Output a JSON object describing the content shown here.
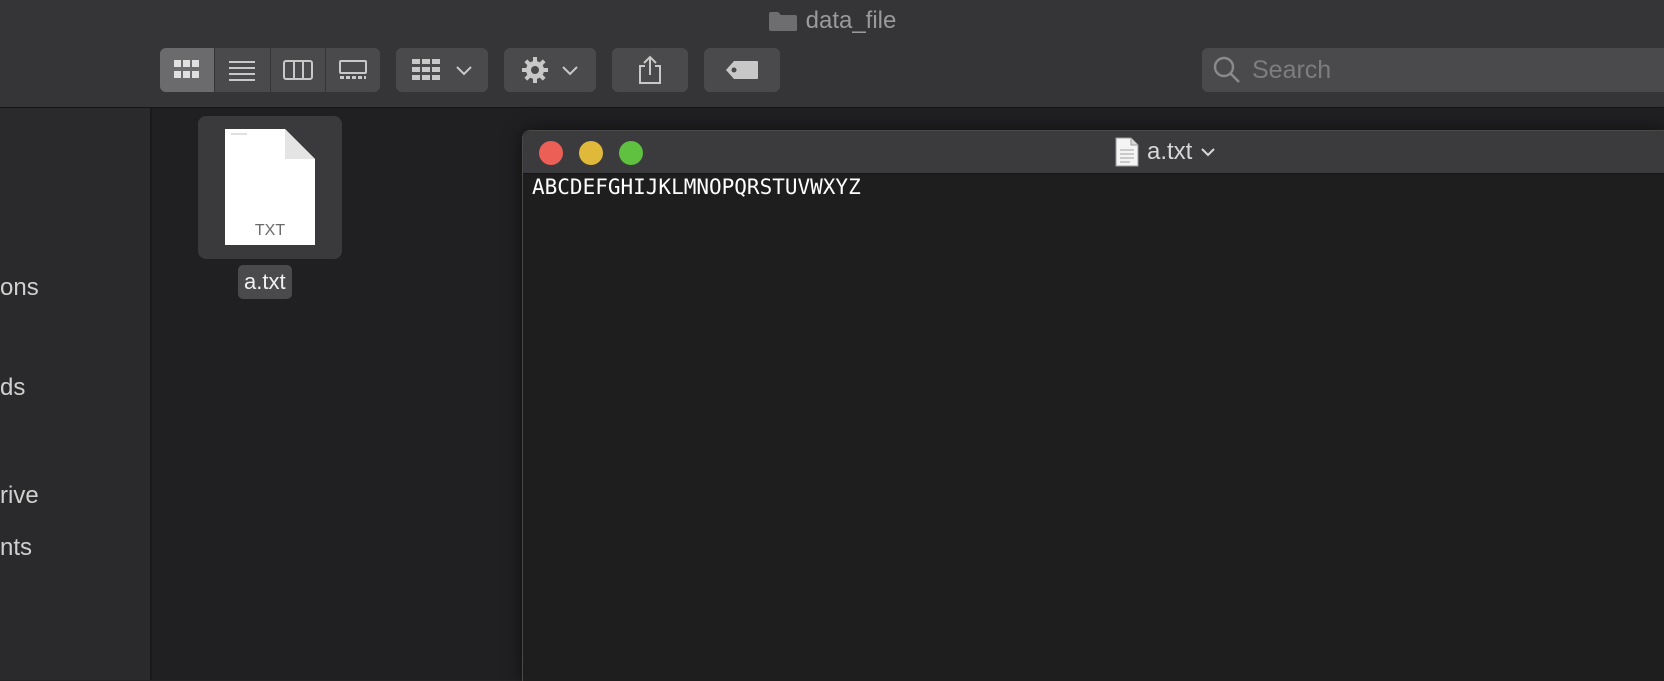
{
  "finder": {
    "window_title": "data_file",
    "search_placeholder": "Search",
    "view_modes": [
      "icon-view",
      "list-view",
      "column-view",
      "gallery-view"
    ]
  },
  "sidebar": {
    "items": [
      {
        "label": "ons"
      },
      {
        "label": "ds"
      },
      {
        "label": "rive"
      },
      {
        "label": "nts"
      }
    ]
  },
  "file": {
    "name": "a.txt",
    "type_label": "TXT"
  },
  "document": {
    "title": "a.txt",
    "content": "ABCDEFGHIJKLMNOPQRSTUVWXYZ"
  },
  "colors": {
    "close": "#ec5f57",
    "minimize": "#e1b93a",
    "zoom": "#5fc13f"
  }
}
